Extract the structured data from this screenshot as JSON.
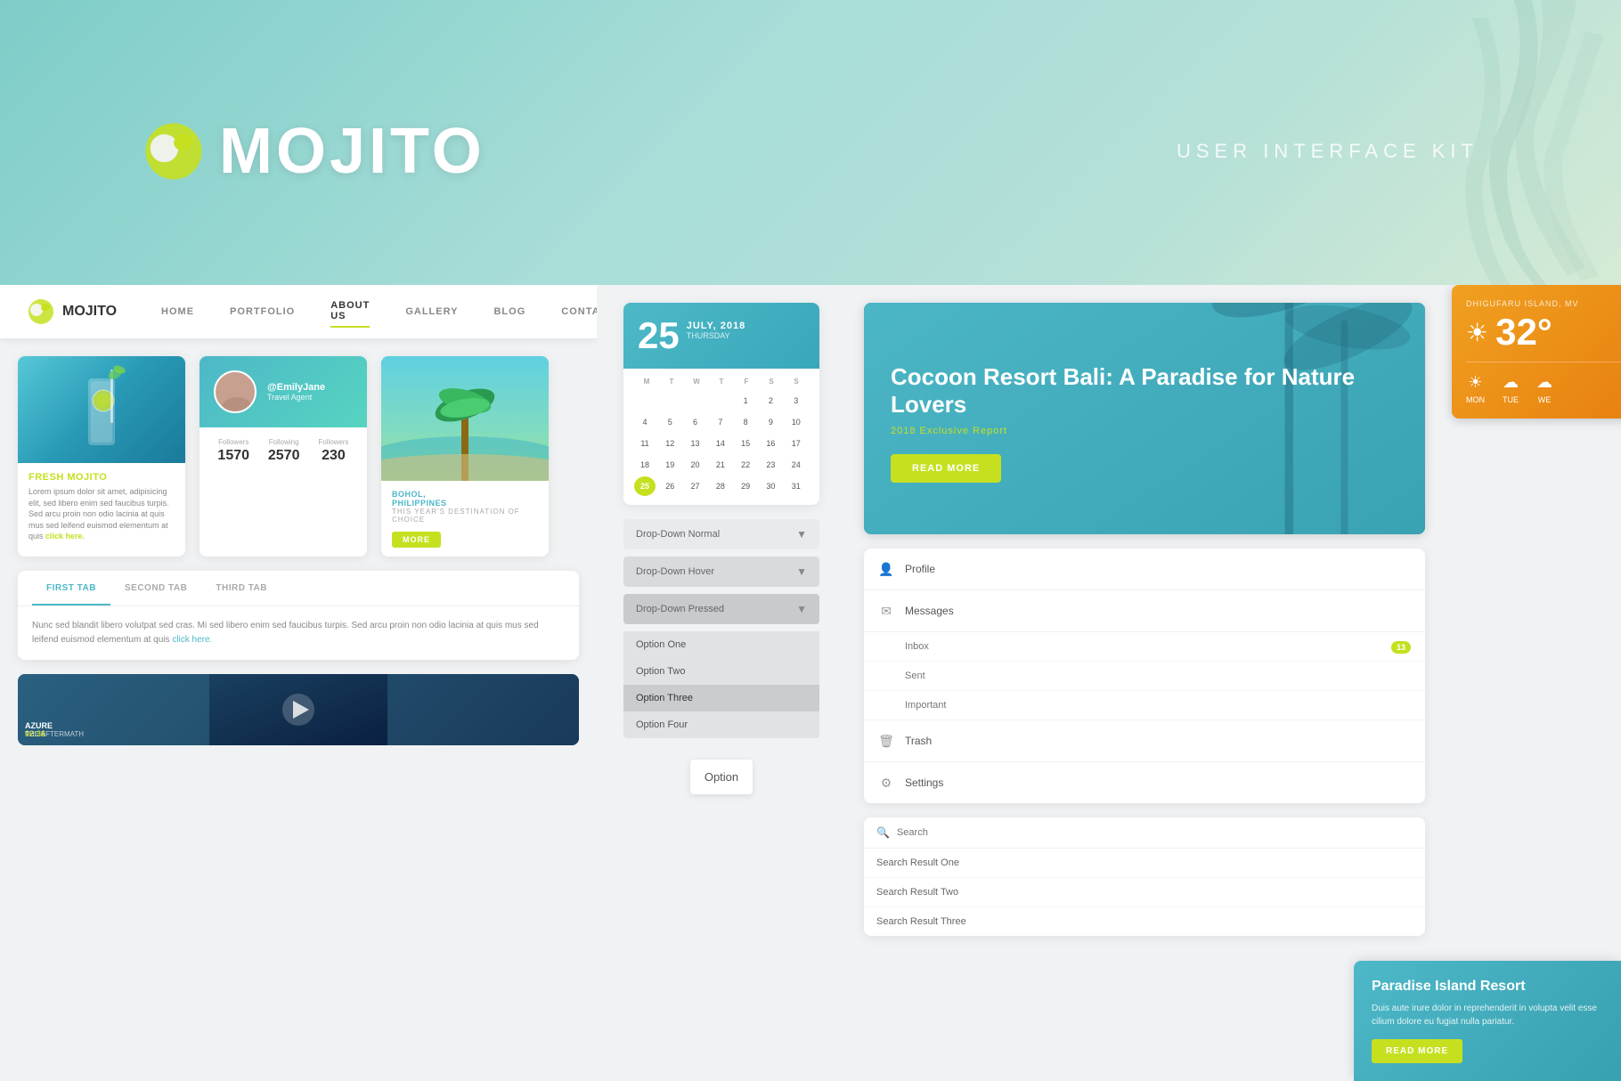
{
  "brand": {
    "name": "MOJITO",
    "tagline": "USER INTERFACE KIT"
  },
  "navbar": {
    "items": [
      {
        "label": "HOME",
        "active": false
      },
      {
        "label": "PORTFOLIO",
        "active": false
      },
      {
        "label": "ABOUT US",
        "active": true
      },
      {
        "label": "GALLERY",
        "active": false
      },
      {
        "label": "BLOG",
        "active": false
      },
      {
        "label": "CONTACT",
        "active": false
      }
    ]
  },
  "article_card": {
    "title": "FRESH MOJITO",
    "text": "Lorem ipsum dolor sit amet, adipisicing elit, sed libero enim sed faucibus turpis. Sed arcu proin non odio lacinia at quis mus sed leifend euismod elementum at quis click here.",
    "link_text": "click here."
  },
  "profile_card": {
    "username": "@EmilyJane",
    "role": "Travel Agent",
    "stats": [
      {
        "label": "Followers",
        "value": "1570"
      },
      {
        "label": "Following",
        "value": "2570"
      },
      {
        "label": "Followers",
        "value": "230"
      }
    ]
  },
  "travel_card": {
    "location": "BOHOL, PHILIPPINES",
    "subtitle": "THIS YEAR'S DESTINATION OF CHOICE",
    "button": "MORE"
  },
  "tabs": {
    "items": [
      {
        "label": "FIRST TAB",
        "active": true
      },
      {
        "label": "SECOND TAB",
        "active": false
      },
      {
        "label": "THIRD TAB",
        "active": false
      }
    ],
    "content": "Nunc sed blandit libero volutpat sed cras. Mi sed libero enim sed faucibus turpis. Sed arcu proin non odio lacinia at quis mus sed leifend euismod elementum at quis click here."
  },
  "video_card": {
    "title": "AZURE",
    "subtitle": "THE AFTERMATH",
    "duration": "02:36"
  },
  "calendar": {
    "day": "25",
    "month_year": "JULY, 2018",
    "weekday": "THURSDAY",
    "day_labels": [
      "M",
      "T",
      "W",
      "T",
      "F",
      "S",
      "S"
    ],
    "weeks": [
      [
        "",
        "",
        "",
        "",
        "1",
        "2",
        "3"
      ],
      [
        "4",
        "5",
        "6",
        "7",
        "8",
        "9",
        "10"
      ],
      [
        "11",
        "12",
        "13",
        "14",
        "15",
        "16",
        "17"
      ],
      [
        "18",
        "19",
        "20",
        "21",
        "22",
        "23",
        "24"
      ],
      [
        "25",
        "26",
        "27",
        "28",
        "29",
        "30",
        "31"
      ]
    ],
    "today": "25"
  },
  "dropdowns": {
    "normal": {
      "label": "Drop-Down Normal",
      "state": "normal"
    },
    "hover": {
      "label": "Drop-Down Hover",
      "state": "hover"
    },
    "pressed": {
      "label": "Drop-Down Pressed",
      "state": "pressed",
      "options": [
        {
          "label": "Option One"
        },
        {
          "label": "Option Two"
        },
        {
          "label": "Option Three",
          "selected": true
        },
        {
          "label": "Option Four"
        }
      ]
    }
  },
  "option_display": {
    "label": "Option"
  },
  "blog_card": {
    "title": "Cocoon Resort Bali: A Paradise for Nature Lovers",
    "subtitle": "2018 Exclusive Report",
    "button": "READ MORE"
  },
  "sidebar_nav": {
    "items": [
      {
        "icon": "person",
        "label": "Profile"
      },
      {
        "icon": "mail",
        "label": "Messages",
        "sub_items": [
          {
            "label": "Inbox",
            "badge": "13"
          },
          {
            "label": "Sent"
          },
          {
            "label": "Important"
          }
        ]
      },
      {
        "icon": "trash",
        "label": "Trash"
      },
      {
        "icon": "gear",
        "label": "Settings"
      }
    ]
  },
  "search": {
    "placeholder": "Search",
    "results": [
      {
        "label": "Search Result One"
      },
      {
        "label": "Search Result Two"
      },
      {
        "label": "Search Result Three"
      }
    ]
  },
  "weather": {
    "location": "DHIGUFARU ISLAND, MV",
    "temperature": "32°",
    "days": [
      "MON",
      "TUE",
      "WE"
    ]
  },
  "promo_card": {
    "title": "Paradise Island Resort",
    "text": "Duis aute irure dolor in reprehenderit in volupta velit esse cilium dolore eu fugiat nulla pariatur.",
    "button": "READ MORE"
  }
}
